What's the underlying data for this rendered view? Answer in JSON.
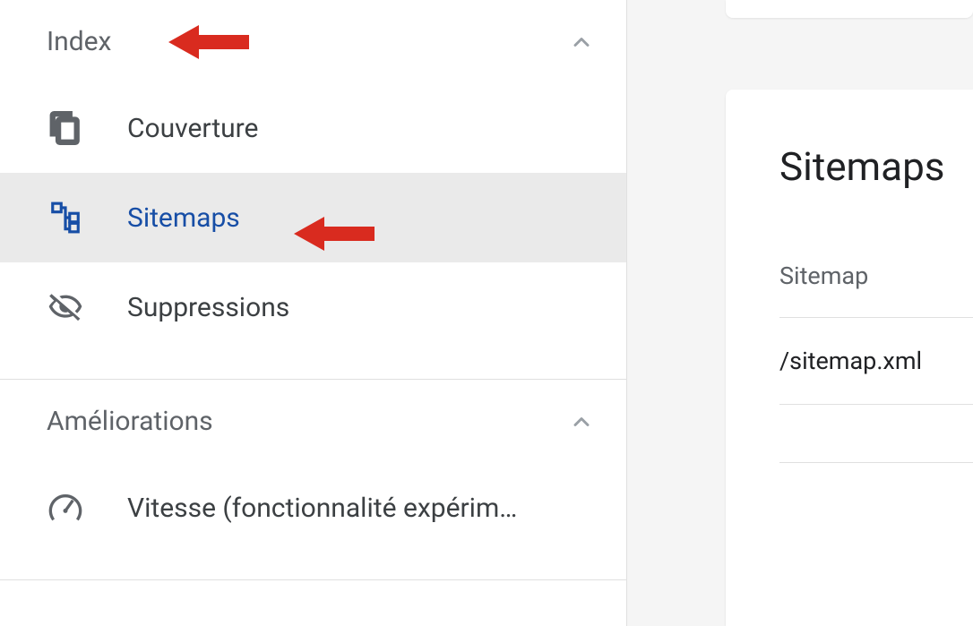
{
  "sidebar": {
    "sections": [
      {
        "title": "Index",
        "items": [
          {
            "label": "Couverture"
          },
          {
            "label": "Sitemaps"
          },
          {
            "label": "Suppressions"
          }
        ]
      },
      {
        "title": "Améliorations",
        "items": [
          {
            "label": "Vitesse (fonctionnalité expérim…"
          }
        ]
      }
    ]
  },
  "panel": {
    "title": "Sitemaps",
    "column_header": "Sitemap",
    "rows": [
      {
        "path": "/sitemap.xml"
      }
    ]
  }
}
